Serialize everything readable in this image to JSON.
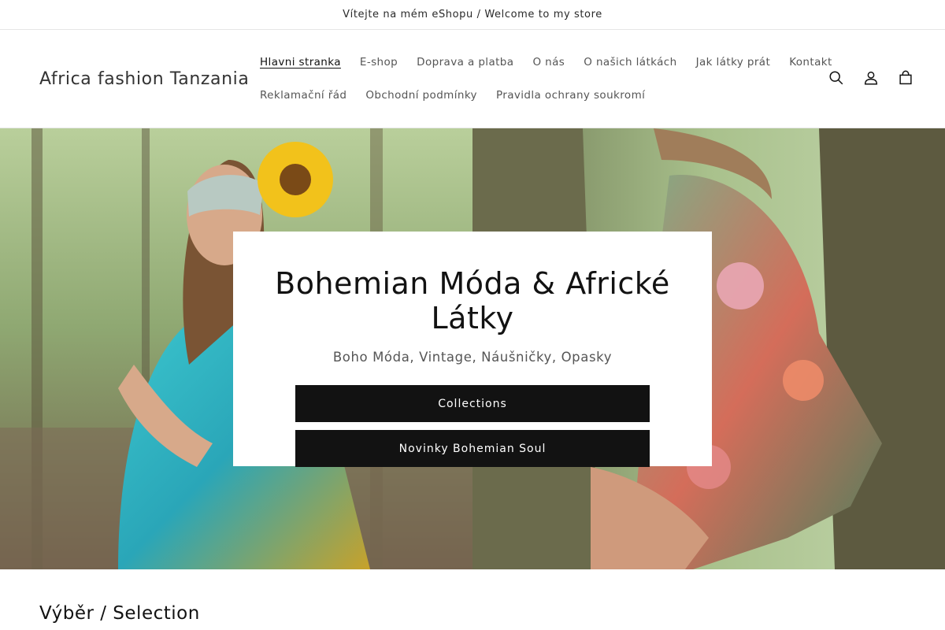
{
  "announcement": "Vítejte na mém eShopu / Welcome to my store",
  "header": {
    "logo": "Africa fashion Tanzania",
    "nav_row1": [
      "Hlavni stranka",
      "E-shop",
      "Doprava a platba",
      "O nás",
      "O našich látkách",
      "Jak látky prát",
      "Kontakt"
    ],
    "nav_row2": [
      "Reklamační řád",
      "Obchodní podmínky",
      "Pravidla ochrany soukromí"
    ],
    "active_item": "Hlavni stranka",
    "icons": [
      "search-icon",
      "account-icon",
      "cart-icon"
    ]
  },
  "hero": {
    "title": "Bohemian Móda & Africké Látky",
    "subtitle": "Boho Móda, Vintage, Náušničky, Opasky",
    "buttons": [
      "Collections",
      "Novinky Bohemian Soul"
    ]
  },
  "section": {
    "title": "Výběr / Selection"
  },
  "colors": {
    "text": "#121212",
    "button_bg": "#121212",
    "button_text": "#ffffff",
    "muted": "#555555"
  }
}
